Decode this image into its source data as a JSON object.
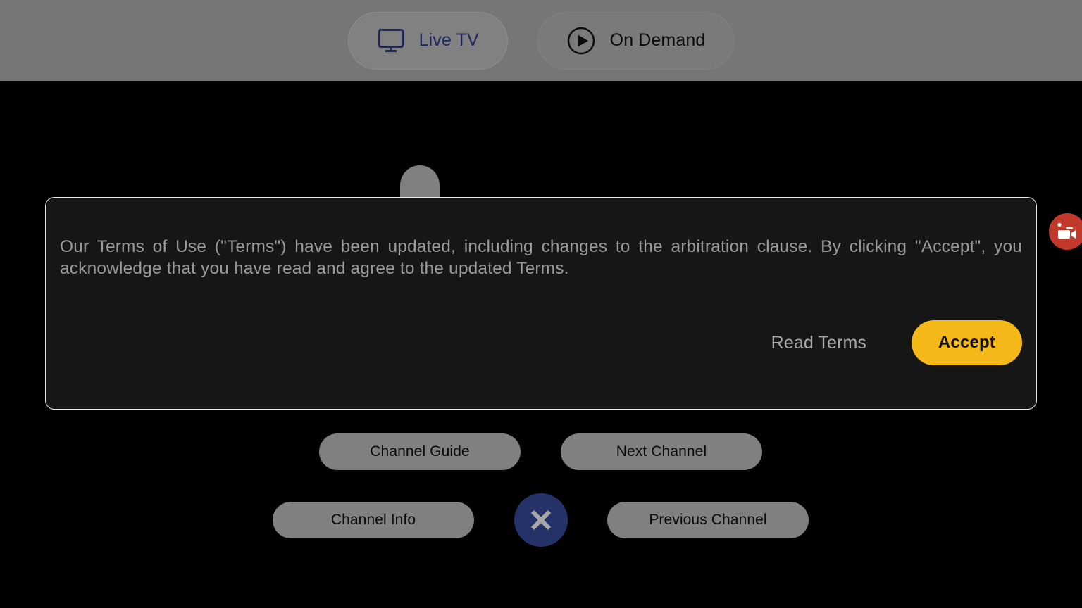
{
  "topbar": {
    "tabs": [
      {
        "label": "Live TV",
        "icon": "monitor-icon",
        "active": true,
        "text_color": "#20275e"
      },
      {
        "label": "On Demand",
        "icon": "play-circle-icon",
        "active": false,
        "text_color": "#0c0c0c"
      }
    ],
    "background_color": "#767676"
  },
  "remote_pad": {
    "buttons": [
      {
        "name": "channel-guide",
        "label": "Channel Guide"
      },
      {
        "name": "next-channel",
        "label": "Next Channel"
      },
      {
        "name": "channel-info",
        "label": "Channel Info"
      },
      {
        "name": "previous-channel",
        "label": "Previous Channel"
      }
    ],
    "close_button": {
      "icon": "close-x-icon",
      "color": "#243268",
      "glyph_color": "#a8a8a8"
    },
    "pill_color": "#808080",
    "pill_text_color": "#0a0a0a"
  },
  "record_indicator": {
    "icon": "video-camera-icon",
    "color": "#c0392b"
  },
  "modal": {
    "message": "Our Terms of Use (\"Terms\") have been updated, including changes to the arbitration clause. By clicking \"Accept\", you acknowledge that you have read and agree to the updated Terms.",
    "read_terms_label": "Read Terms",
    "accept_label": "Accept",
    "accent_color": "#f5b819",
    "background_color": "#161616",
    "border_color": "#e8e8e8",
    "text_color": "#9a9a9a"
  }
}
